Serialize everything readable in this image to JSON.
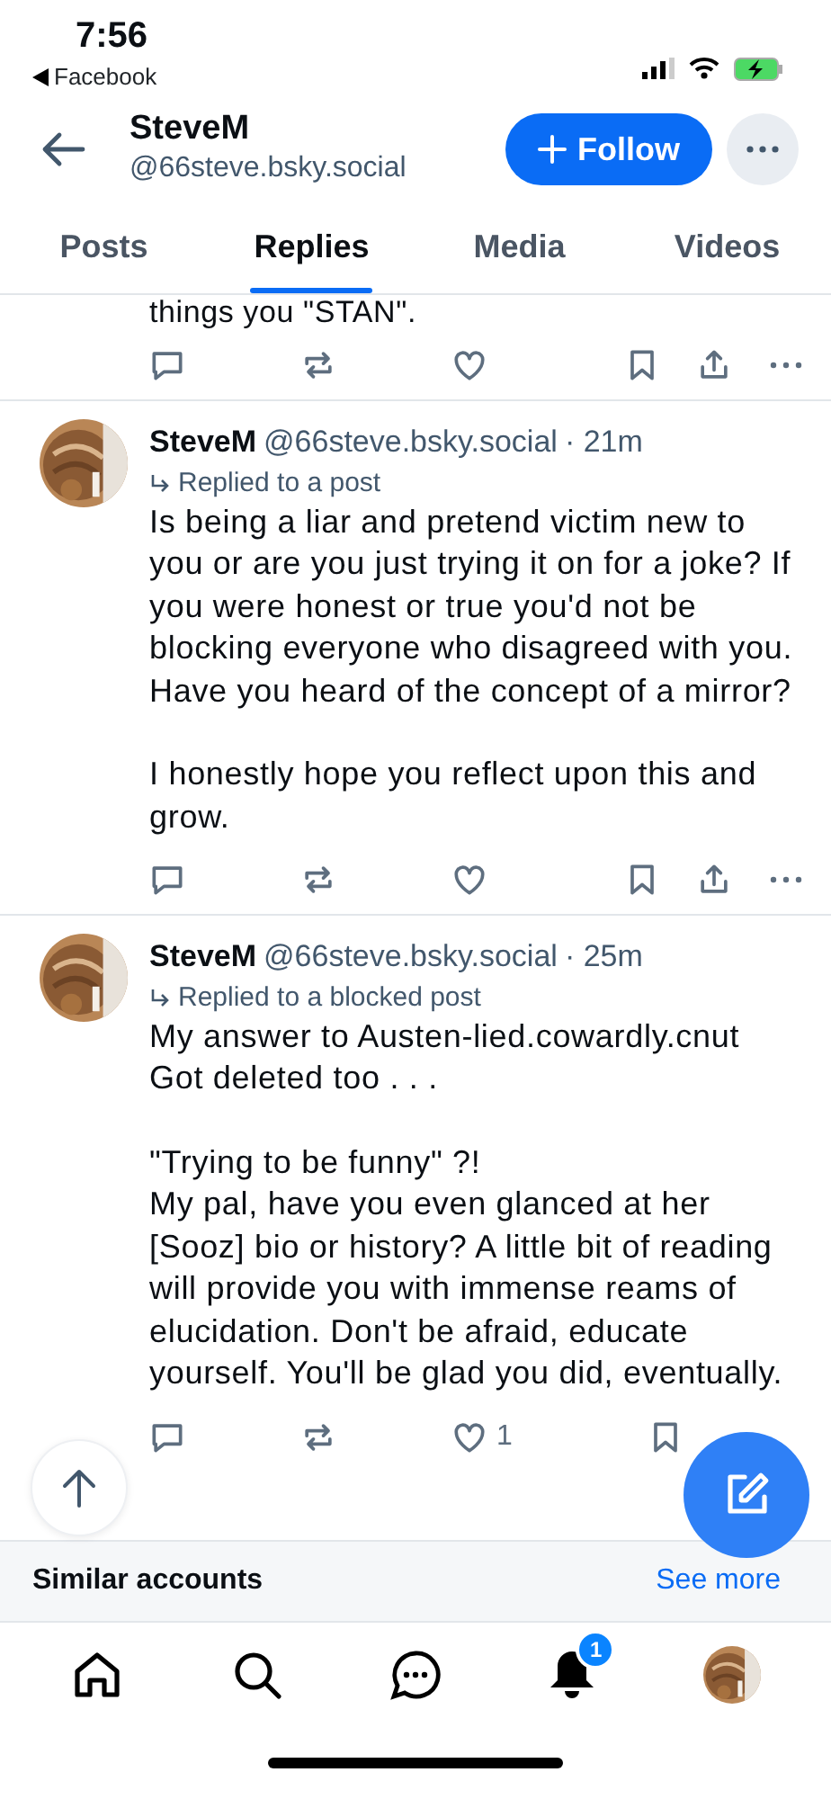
{
  "status_bar": {
    "time": "7:56",
    "back_app": "Facebook"
  },
  "header": {
    "name": "SteveM",
    "handle": "@66steve.bsky.social",
    "follow_button": "Follow"
  },
  "tabs": [
    {
      "label": "Posts",
      "selected": false
    },
    {
      "label": "Replies",
      "selected": true
    },
    {
      "label": "Media",
      "selected": false
    },
    {
      "label": "Videos",
      "selected": false
    }
  ],
  "partial_post": {
    "text": "things you \"STAN\"."
  },
  "posts": [
    {
      "name": "SteveM",
      "handle": "@66steve.bsky.social",
      "time": "· 21m",
      "reply_context": "Replied to a post",
      "paragraphs": [
        "Is being a liar and pretend victim new to you or are you just trying it on for a joke? If you were honest or true you'd not be blocking everyone who disagreed with you. Have you heard of the concept of a mirror?",
        "I honestly hope you reflect upon this and grow."
      ]
    },
    {
      "name": "SteveM",
      "handle": "@66steve.bsky.social",
      "time": "· 25m",
      "reply_context": "Replied to a blocked post",
      "paragraphs": [
        "My answer to Austen-lied.cowardly.cnut\nGot deleted too . . .",
        "\"Trying to be funny\" ?!\nMy pal, have you even glanced at her [Sooz] bio or history? A little bit of reading will provide you with immense reams of elucidation. Don't be afraid, educate yourself. You'll be glad you did, eventually."
      ],
      "like_count": "1"
    }
  ],
  "similar_accounts": {
    "title": "Similar accounts",
    "link": "See more"
  },
  "bottom_nav": {
    "notifications_badge": "1"
  }
}
